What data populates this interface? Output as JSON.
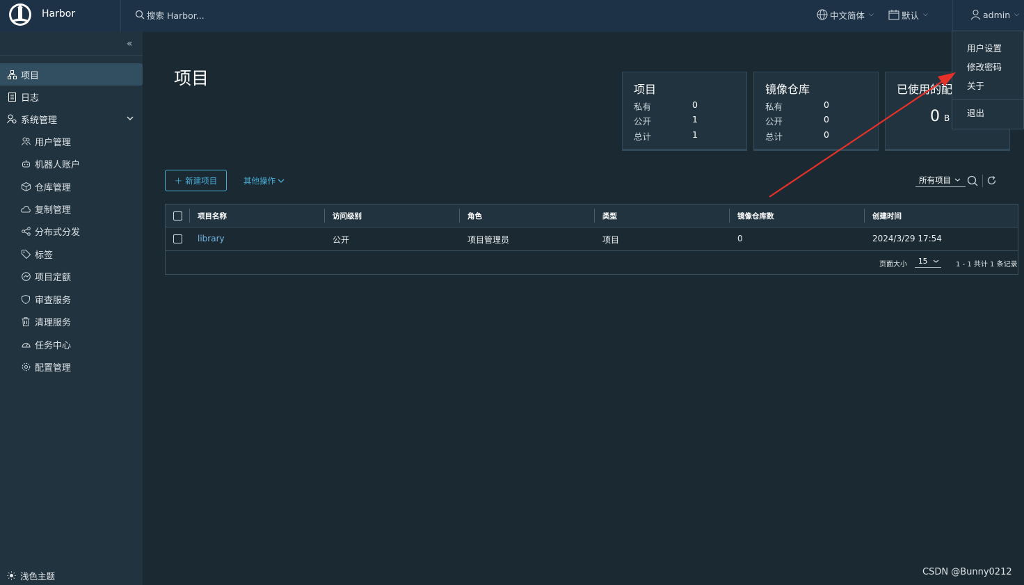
{
  "header": {
    "brand": "Harbor",
    "search_placeholder": "搜索 Harbor...",
    "language": "中文简体",
    "theme_select": "默认",
    "user": "admin"
  },
  "sidebar": {
    "items": [
      {
        "label": "项目",
        "icon": "projects-icon",
        "active": true
      },
      {
        "label": "日志",
        "icon": "logs-icon"
      },
      {
        "label": "系统管理",
        "icon": "admin-icon",
        "expanded": true
      }
    ],
    "sub_items": [
      {
        "label": "用户管理",
        "icon": "users-icon"
      },
      {
        "label": "机器人账户",
        "icon": "robot-icon"
      },
      {
        "label": "仓库管理",
        "icon": "registry-icon"
      },
      {
        "label": "复制管理",
        "icon": "replication-icon"
      },
      {
        "label": "分布式分发",
        "icon": "distribution-icon"
      },
      {
        "label": "标签",
        "icon": "tag-icon"
      },
      {
        "label": "项目定额",
        "icon": "quota-icon"
      },
      {
        "label": "审查服务",
        "icon": "shield-icon"
      },
      {
        "label": "清理服务",
        "icon": "trash-icon"
      },
      {
        "label": "任务中心",
        "icon": "dashboard-icon"
      },
      {
        "label": "配置管理",
        "icon": "gear-icon"
      }
    ],
    "theme_toggle": "浅色主题"
  },
  "main": {
    "title": "项目",
    "cards": {
      "projects": {
        "title": "项目",
        "rows": [
          {
            "label": "私有",
            "value": "0"
          },
          {
            "label": "公开",
            "value": "1"
          },
          {
            "label": "总计",
            "value": "1"
          }
        ]
      },
      "repositories": {
        "title": "镜像仓库",
        "rows": [
          {
            "label": "私有",
            "value": "0"
          },
          {
            "label": "公开",
            "value": "0"
          },
          {
            "label": "总计",
            "value": "0"
          }
        ]
      },
      "quota": {
        "title": "已使用的配",
        "value": "0",
        "unit": "B"
      }
    },
    "toolbar": {
      "new_project": "新建项目",
      "other_actions": "其他操作",
      "filter": "所有项目"
    },
    "table": {
      "columns": [
        "项目名称",
        "访问级别",
        "角色",
        "类型",
        "镜像仓库数",
        "创建时间"
      ],
      "rows": [
        [
          "library",
          "公开",
          "项目管理员",
          "项目",
          "0",
          "2024/3/29 17:54"
        ]
      ],
      "footer": {
        "page_size_label": "页面大小",
        "page_size": "15",
        "summary": "1 - 1 共计 1 条记录"
      }
    }
  },
  "user_menu": {
    "items": [
      "用户设置",
      "修改密码",
      "关于"
    ],
    "logout": "退出"
  },
  "annotation": {
    "color": "#e8302a"
  },
  "watermark": "CSDN @Bunny0212"
}
